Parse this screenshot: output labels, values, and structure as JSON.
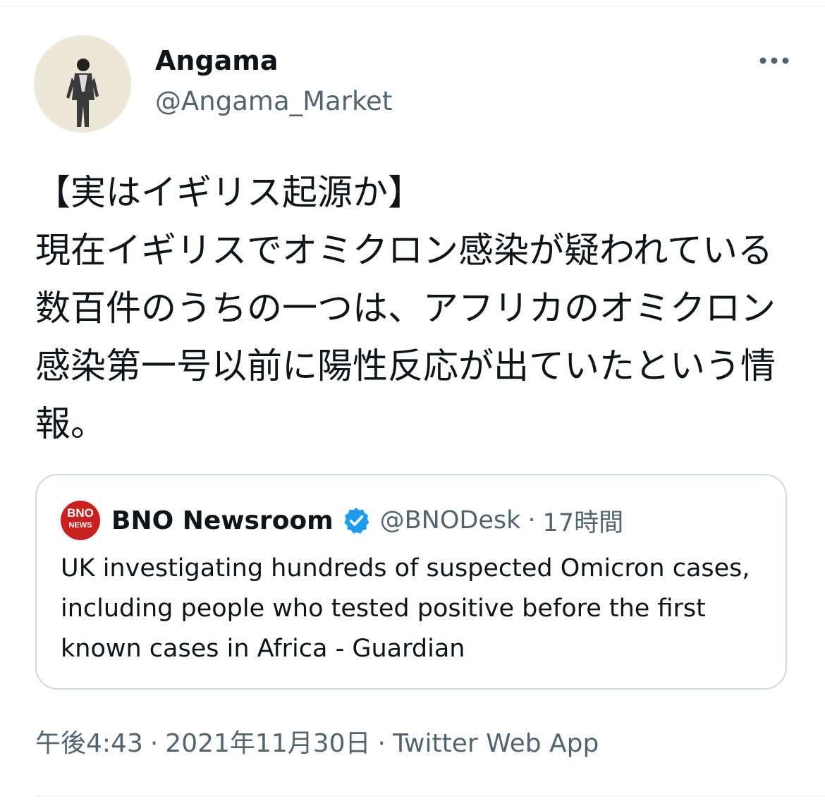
{
  "author": {
    "display_name": "Angama",
    "handle": "@Angama_Market",
    "avatar_icon": "person-photo-avatar"
  },
  "more_icon": "more-horizontal-icon",
  "tweet": {
    "text": "【実はイギリス起源か】\n現在イギリスでオミクロン感染が疑われている数百件のうちの一つは、アフリカのオミクロン感染第一号以前に陽性反応が出ていたという情報。"
  },
  "quoted_tweet": {
    "logo_text_top": "BNO",
    "logo_text_bottom": "NEWS",
    "logo_color": "#c8201e",
    "name": "BNO Newsroom",
    "verified_icon": "verified-badge-icon",
    "verified_color": "#1d9bf0",
    "handle": "@BNODesk",
    "separator": "·",
    "time": "17時間",
    "text": "UK investigating hundreds of suspected Omicron cases, including people who tested positive before the first known cases in Africa - Guardian"
  },
  "meta": {
    "time": "午後4:43",
    "separator": "·",
    "date": "2021年11月30日",
    "source": "Twitter Web App"
  }
}
